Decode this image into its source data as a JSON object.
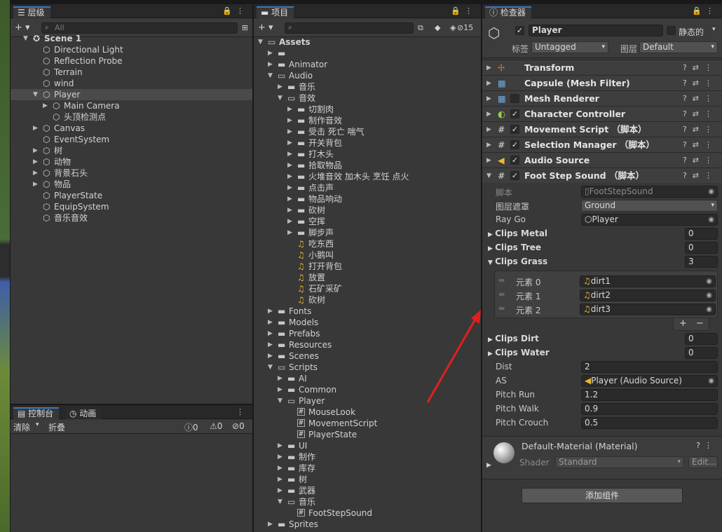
{
  "hierarchy": {
    "tab_label": "层级",
    "search_placeholder": "All",
    "rows": [
      {
        "label": "Scene 1",
        "indent": 0
      },
      {
        "label": "Directional Light",
        "indent": 1
      },
      {
        "label": "Reflection Probe",
        "indent": 1
      },
      {
        "label": "Terrain",
        "indent": 1
      },
      {
        "label": "wind",
        "indent": 1
      },
      {
        "label": "Player",
        "indent": 1
      },
      {
        "label": "Main Camera",
        "indent": 2
      },
      {
        "label": "头顶检测点",
        "indent": 2
      },
      {
        "label": "Canvas",
        "indent": 1
      },
      {
        "label": "EventSystem",
        "indent": 1
      },
      {
        "label": "树",
        "indent": 1
      },
      {
        "label": "动物",
        "indent": 1
      },
      {
        "label": "背景石头",
        "indent": 1
      },
      {
        "label": "物品",
        "indent": 1
      },
      {
        "label": "PlayerState",
        "indent": 1
      },
      {
        "label": "EquipSystem",
        "indent": 1
      },
      {
        "label": "音乐音效",
        "indent": 1
      }
    ]
  },
  "console": {
    "tab_label": "控制台",
    "tab2_label": "动画",
    "clear_label": "清除",
    "collapse_label": "折叠",
    "count_info": "0",
    "count_warn": "0",
    "count_error": "0"
  },
  "project": {
    "tab_label": "项目",
    "hidden_count": "15",
    "rows": [
      {
        "label": "Assets",
        "indent": 0,
        "type": "folder",
        "open": true
      },
      {
        "label": "",
        "indent": 1,
        "type": "folder"
      },
      {
        "label": "Animator",
        "indent": 1,
        "type": "folder"
      },
      {
        "label": "Audio",
        "indent": 1,
        "type": "folder",
        "open": true
      },
      {
        "label": "音乐",
        "indent": 2,
        "type": "folder"
      },
      {
        "label": "音效",
        "indent": 2,
        "type": "folder",
        "open": true
      },
      {
        "label": "切割肉",
        "indent": 3,
        "type": "folder"
      },
      {
        "label": "制作音效",
        "indent": 3,
        "type": "folder"
      },
      {
        "label": "受击 死亡 喘气",
        "indent": 3,
        "type": "folder"
      },
      {
        "label": "开关背包",
        "indent": 3,
        "type": "folder"
      },
      {
        "label": "打木头",
        "indent": 3,
        "type": "folder"
      },
      {
        "label": "拾取物品",
        "indent": 3,
        "type": "folder"
      },
      {
        "label": "火堆音效 加木头 烹饪 点火",
        "indent": 3,
        "type": "folder"
      },
      {
        "label": "点击声",
        "indent": 3,
        "type": "folder"
      },
      {
        "label": "物品响动",
        "indent": 3,
        "type": "folder"
      },
      {
        "label": "砍树",
        "indent": 3,
        "type": "folder"
      },
      {
        "label": "空挥",
        "indent": 3,
        "type": "folder"
      },
      {
        "label": "脚步声",
        "indent": 3,
        "type": "folder"
      },
      {
        "label": "吃东西",
        "indent": 3,
        "type": "audio"
      },
      {
        "label": "小鹅叫",
        "indent": 3,
        "type": "audio"
      },
      {
        "label": "打开背包",
        "indent": 3,
        "type": "audio"
      },
      {
        "label": "放置",
        "indent": 3,
        "type": "audio"
      },
      {
        "label": "石矿采矿",
        "indent": 3,
        "type": "audio"
      },
      {
        "label": "砍树",
        "indent": 3,
        "type": "audio"
      },
      {
        "label": "Fonts",
        "indent": 1,
        "type": "folder"
      },
      {
        "label": "Models",
        "indent": 1,
        "type": "folder"
      },
      {
        "label": "Prefabs",
        "indent": 1,
        "type": "folder"
      },
      {
        "label": "Resources",
        "indent": 1,
        "type": "folder"
      },
      {
        "label": "Scenes",
        "indent": 1,
        "type": "folder"
      },
      {
        "label": "Scripts",
        "indent": 1,
        "type": "folder",
        "open": true
      },
      {
        "label": "AI",
        "indent": 2,
        "type": "folder"
      },
      {
        "label": "Common",
        "indent": 2,
        "type": "folder"
      },
      {
        "label": "Player",
        "indent": 2,
        "type": "folder",
        "open": true
      },
      {
        "label": "MouseLook",
        "indent": 3,
        "type": "script"
      },
      {
        "label": "MovementScript",
        "indent": 3,
        "type": "script"
      },
      {
        "label": "PlayerState",
        "indent": 3,
        "type": "script"
      },
      {
        "label": "UI",
        "indent": 2,
        "type": "folder"
      },
      {
        "label": "制作",
        "indent": 2,
        "type": "folder"
      },
      {
        "label": "库存",
        "indent": 2,
        "type": "folder"
      },
      {
        "label": "树",
        "indent": 2,
        "type": "folder"
      },
      {
        "label": "武器",
        "indent": 2,
        "type": "folder"
      },
      {
        "label": "音乐",
        "indent": 2,
        "type": "folder",
        "open": true
      },
      {
        "label": "FootStepSound",
        "indent": 3,
        "type": "script"
      },
      {
        "label": "Sprites",
        "indent": 1,
        "type": "folder"
      }
    ]
  },
  "inspector": {
    "tab_label": "检查器",
    "object_name": "Player",
    "static_label": "静态的",
    "tag_label": "标签",
    "tag_value": "Untagged",
    "layer_label": "图层",
    "layer_value": "Default",
    "components": [
      {
        "label": "Transform",
        "check": false
      },
      {
        "label": "Capsule (Mesh Filter)",
        "check": false
      },
      {
        "label": "Mesh Renderer",
        "check": false
      },
      {
        "label": "Character Controller",
        "check": true
      },
      {
        "label": "Movement Script （脚本）",
        "check": true
      },
      {
        "label": "Selection Manager （脚本）",
        "check": true
      },
      {
        "label": "Audio Source",
        "check": true
      },
      {
        "label": "Foot Step Sound （脚本）",
        "check": true
      }
    ],
    "props": {
      "script_label": "脚本",
      "script_value": "FootStepSound",
      "layermask_label": "图层遮罩",
      "layermask_value": "Ground",
      "raygo_label": "Ray Go",
      "raygo_value": "Player",
      "clips_metal_label": "Clips Metal",
      "clips_metal_value": "0",
      "clips_tree_label": "Clips Tree",
      "clips_tree_value": "0",
      "clips_grass_label": "Clips Grass",
      "clips_grass_value": "3",
      "elem0_label": "元素 0",
      "elem0_value": "dirt1",
      "elem1_label": "元素 1",
      "elem1_value": "dirt2",
      "elem2_label": "元素 2",
      "elem2_value": "dirt3",
      "clips_dirt_label": "Clips Dirt",
      "clips_dirt_value": "0",
      "clips_water_label": "Clips Water",
      "clips_water_value": "0",
      "dist_label": "Dist",
      "dist_value": "2",
      "as_label": "AS",
      "as_value": "Player (Audio Source)",
      "pitch_run_label": "Pitch Run",
      "pitch_run_value": "1.2",
      "pitch_walk_label": "Pitch Walk",
      "pitch_walk_value": "0.9",
      "pitch_crouch_label": "Pitch Crouch",
      "pitch_crouch_value": "0.5"
    },
    "material_name": "Default-Material (Material)",
    "shader_label": "Shader",
    "shader_value": "Standard",
    "edit_label": "Edit...",
    "add_component_label": "添加组件"
  },
  "colors": {
    "accent": "#3a79bb",
    "arrow": "#e02020"
  }
}
